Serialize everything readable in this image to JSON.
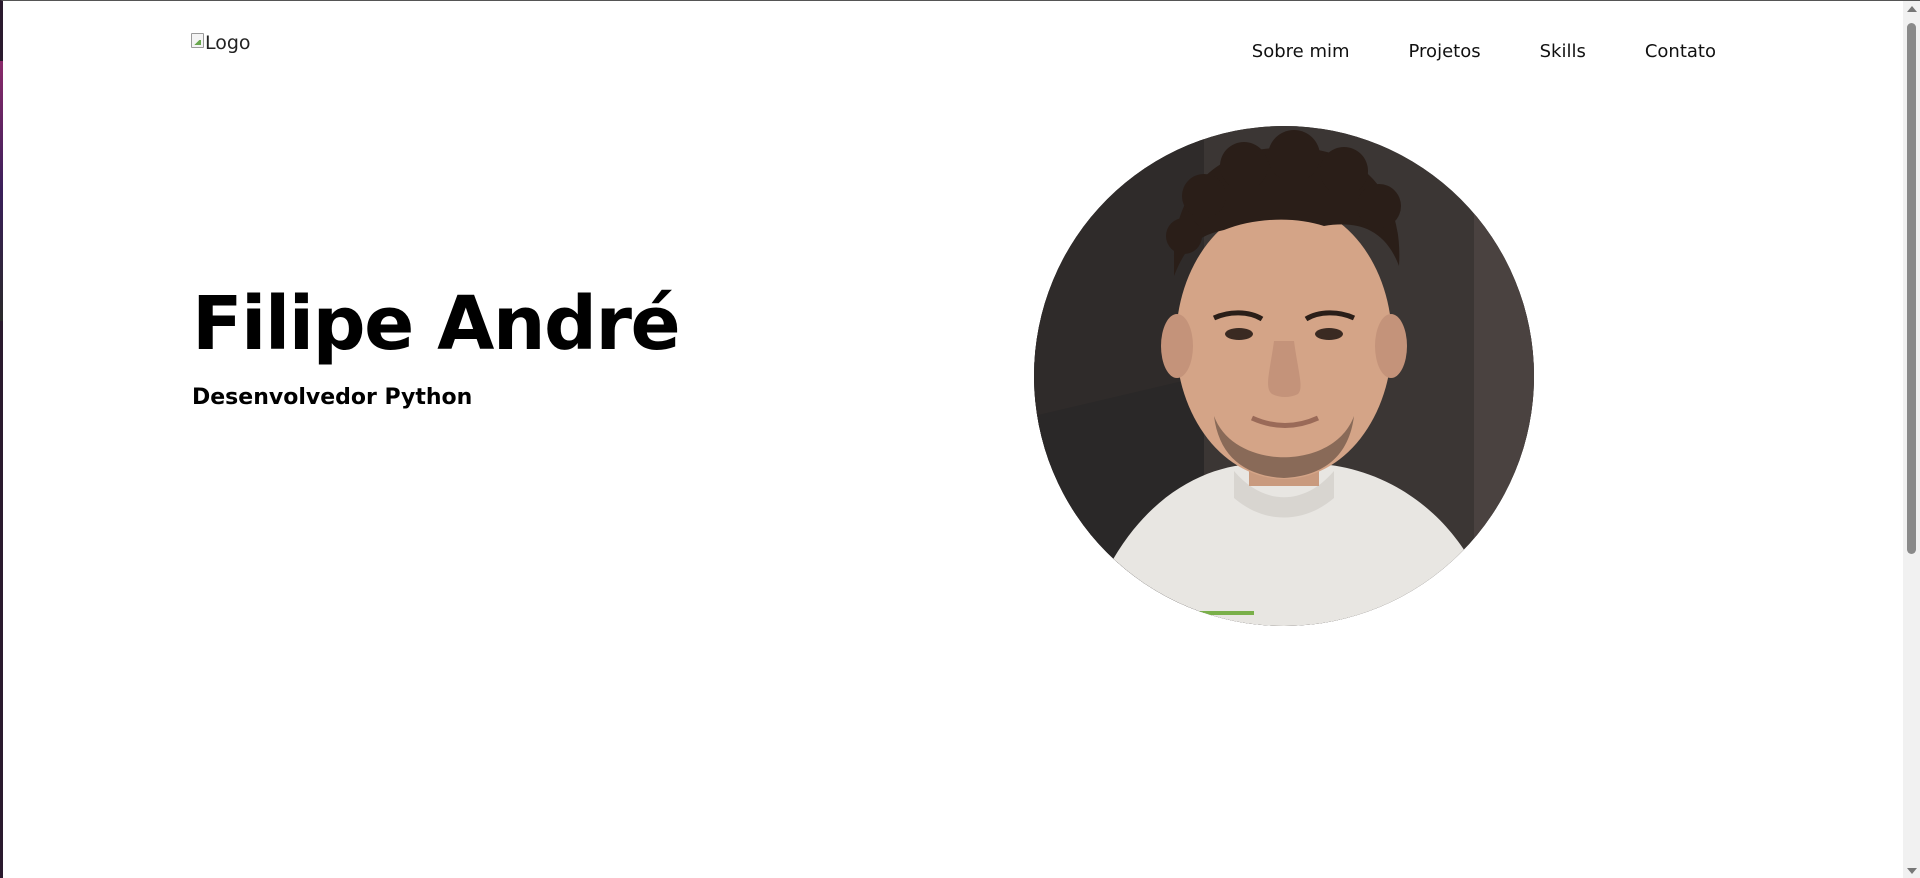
{
  "header": {
    "logo_alt": "Logo",
    "nav": [
      "Sobre mim",
      "Projetos",
      "Skills",
      "Contato"
    ]
  },
  "hero": {
    "name": "Filipe André",
    "role": "Desenvolvedor Python"
  },
  "colors": {
    "background": "#ffffff",
    "text": "#000000",
    "portrait_backdrop": "#3b3634",
    "hoodie": "#e8e6e2"
  }
}
